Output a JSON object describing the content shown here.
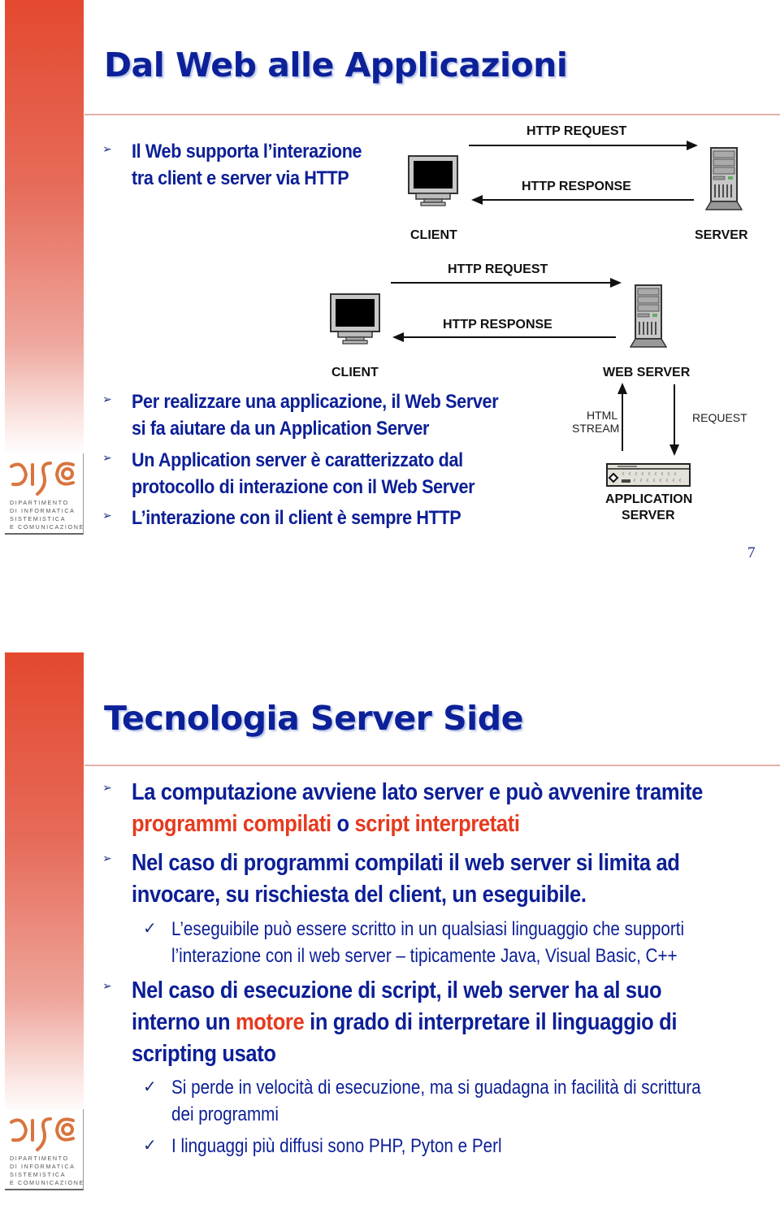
{
  "slides": [
    {
      "title": "Dal Web alle Applicazioni",
      "bullets": [
        {
          "lines": [
            "Il Web supporta l’interazione",
            "tra client e server via HTTP"
          ]
        },
        {
          "lines": [
            "Per realizzare una applicazione, il Web Server",
            "si fa aiutare da un Application Server"
          ]
        },
        {
          "lines": [
            "Un Application server è caratterizzato dal",
            "protocollo di interazione con il Web Server"
          ]
        },
        {
          "lines": [
            "L’interazione con il client è sempre HTTP"
          ]
        }
      ],
      "diagram1": {
        "request": "HTTP REQUEST",
        "response": "HTTP RESPONSE",
        "client": "CLIENT",
        "server": "SERVER",
        "icons": [
          "monitor-icon",
          "server-tower-icon"
        ]
      },
      "diagram2": {
        "request": "HTTP REQUEST",
        "response": "HTTP RESPONSE",
        "client": "CLIENT",
        "web_server": "WEB SERVER",
        "html_stream_1": "HTML",
        "html_stream_2": "STREAM",
        "request_down": "REQUEST",
        "app_server_1": "APPLICATION",
        "app_server_2": "SERVER",
        "icons": [
          "monitor-icon",
          "server-tower-icon",
          "rack-server-icon"
        ]
      },
      "page_number": "7"
    },
    {
      "title": "Tecnologia Server Side",
      "b1_l1": "La computazione avviene lato server e può avvenire tramite",
      "b1_l2_red1": "programmi compilati",
      "b1_l2_mid": " o ",
      "b1_l2_red2": "script interpretati",
      "b2_l1": "Nel caso di programmi compilati il web server si limita ad",
      "b2_l2": "invocare, su rischiesta del client, un eseguibile.",
      "s1_l1": "L’eseguibile può essere scritto in un qualsiasi linguaggio che supporti",
      "s1_l2": "l’interazione con il web server – tipicamente Java, Visual Basic, C++",
      "b3_l1": "Nel caso di esecuzione di script, il web server ha al suo",
      "b3_l2_pre": "interno un ",
      "b3_l2_red": "motore",
      "b3_l2_post": " in grado di interpretare il linguaggio di",
      "b3_l3": "scripting usato",
      "s2_l1": "Si perde in velocità di esecuzione, ma si guadagna in facilità di scrittura",
      "s2_l2": "dei programmi",
      "s3_l1": "I linguaggi più diffusi sono PHP, Pyton e Perl"
    }
  ],
  "logo": {
    "mark": "DISCO",
    "lines": [
      "DIPARTIMENTO",
      "DI INFORMATICA",
      "SISTEMISTICA",
      "E COMUNICAZIONE"
    ]
  },
  "glyphs": {
    "bullet_arrow": "➢",
    "check": "✓"
  },
  "colors": {
    "title": "#0c2199",
    "body": "#0c1f96",
    "highlight": "#e63a1e",
    "sidebar": "#e4492f"
  }
}
